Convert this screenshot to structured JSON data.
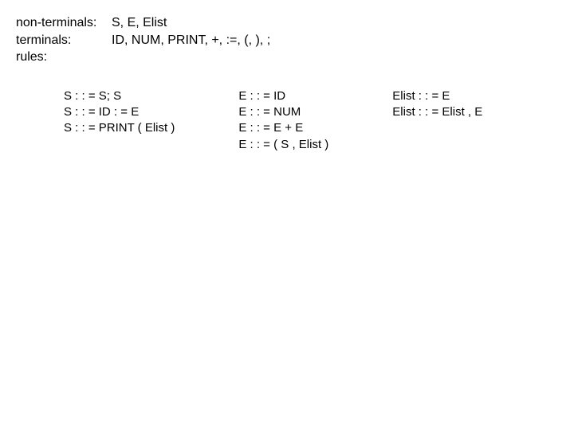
{
  "defs": {
    "nonterminals_label": "non-terminals:",
    "nonterminals_value": "S, E, Elist",
    "terminals_label": "terminals:",
    "terminals_value": "ID, NUM, PRINT, +, :=, (, ), ;",
    "rules_label": "rules:"
  },
  "rules_cols": [
    {
      "lines": [
        "S : : = S; S",
        "S : : = ID : = E",
        "S : : = PRINT ( Elist )"
      ]
    },
    {
      "lines": [
        "E : : = ID",
        "E : : = NUM",
        "E : : = E + E",
        "E : : = ( S , Elist )"
      ]
    },
    {
      "lines": [
        "Elist : : = E",
        "Elist : : = Elist , E"
      ]
    }
  ]
}
